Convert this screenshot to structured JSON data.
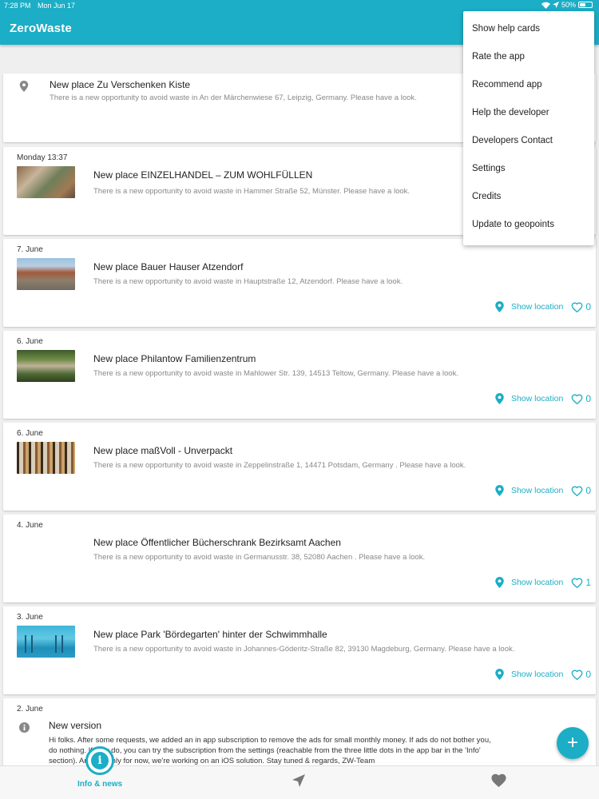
{
  "status_bar": {
    "time": "7:28 PM",
    "date": "Mon Jun 17",
    "battery": "50%",
    "battery_level": 0.5
  },
  "app_bar": {
    "title": "ZeroWaste"
  },
  "menu": {
    "items": [
      "Show help cards",
      "Rate the app",
      "Recommend app",
      "Help the developer",
      "Developers Contact",
      "Settings",
      "Credits",
      "Update to geopoints"
    ]
  },
  "feed": {
    "show_location_label": "Show location",
    "cards": [
      {
        "date": "",
        "title": "New place Zu Verschenken Kiste",
        "desc": "There is a new opportunity to avoid waste in An der Märchenwiese 67, Leipzig, Germany. Please have a look."
      },
      {
        "date": "Monday 13:37",
        "title": "New place EINZELHANDEL – ZUM WOHLFÜLLEN",
        "desc": "There is a new opportunity to avoid waste in Hammer Straße 52, Münster. Please have a look."
      },
      {
        "date": "7. June",
        "title": "New place Bauer Hauser Atzendorf",
        "desc": "There is a new opportunity to avoid waste in Hauptstraße 12, Atzendorf. Please have a look.",
        "likes": "0"
      },
      {
        "date": "6. June",
        "title": "New place Philantow Familienzentrum",
        "desc": "There is a new opportunity to avoid waste in Mahlower Str. 139, 14513 Teltow, Germany. Please have a look.",
        "likes": "0"
      },
      {
        "date": "6. June",
        "title": "New place maßVoll - Unverpackt",
        "desc": "There is a new opportunity to avoid waste in  Zeppelinstraße 1, 14471 Potsdam, Germany . Please have a look.",
        "likes": "0"
      },
      {
        "date": "4. June",
        "title": "New place Öffentlicher Bücherschrank Bezirksamt Aachen",
        "desc": "There is a new opportunity to avoid waste in Germanusstr. 38, 52080 Aachen . Please have a look.",
        "likes": "1"
      },
      {
        "date": "3. June",
        "title": "New place Park 'Bördegarten' hinter der Schwimmhalle",
        "desc": "There is a new opportunity to avoid waste in Johannes-Göderitz-Straße 82, 39130 Magdeburg, Germany. Please have a look.",
        "likes": "0"
      },
      {
        "date": "2. June",
        "title": "New version",
        "body": [
          "Hi folks. After some requests, we added an in app subscription to remove the ads for small monthly money. If ads do not bother you,",
          "do nothing. If they do, you can try the subscription from the settings (reachable from the three little dots in the app bar in the 'Info'",
          "section). Android only for now, we're working on an iOS solution. Stay tuned & regards, ZW-Team"
        ]
      }
    ]
  },
  "fab": {
    "label": "+"
  },
  "bottom_nav": {
    "info_label": "Info & news"
  },
  "colors": {
    "accent": "#1baec6",
    "background": "#efefef"
  }
}
